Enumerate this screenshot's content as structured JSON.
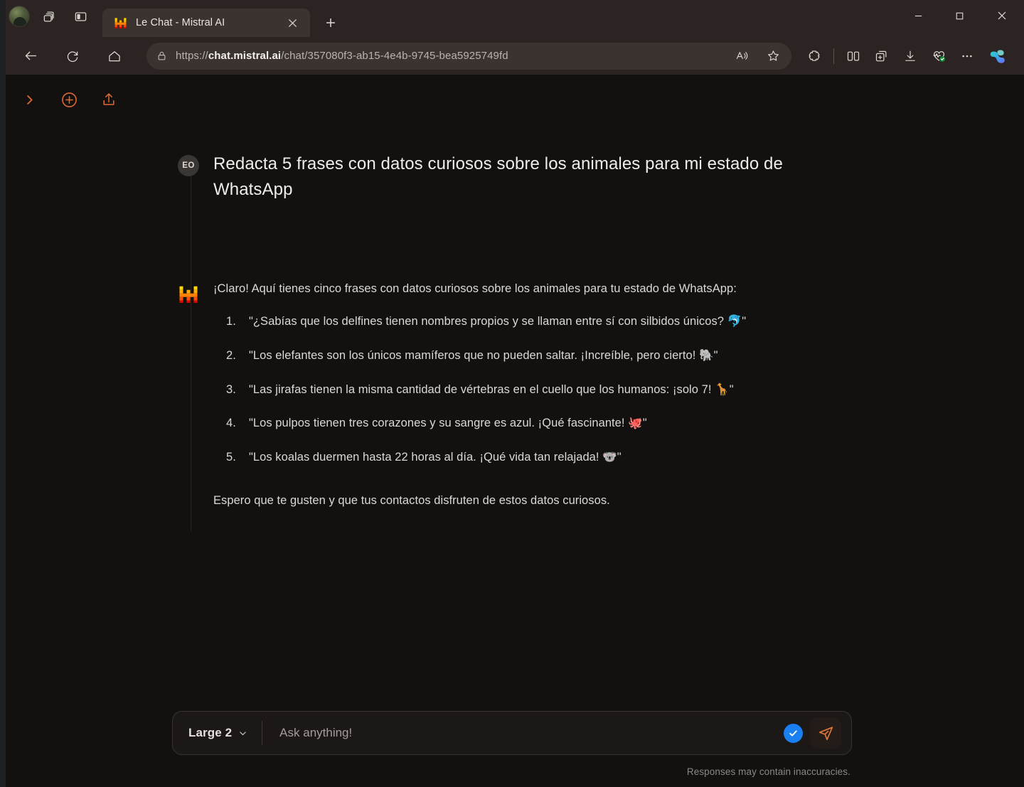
{
  "browser": {
    "tab": {
      "title": "Le Chat - Mistral AI",
      "favicon_name": "mistral-logo-icon",
      "close_label": "×"
    },
    "new_tab_label": "+",
    "omnibox": {
      "url_scheme": "https://",
      "url_host": "chat.mistral.ai",
      "url_path": "/chat/357080f3-ab15-4e4b-9745-bea5925749fd",
      "lock_icon": "lock-icon",
      "read_aloud_icon": "read-aloud-icon",
      "favorite_icon": "star-icon"
    },
    "nav": {
      "back_icon": "back-arrow-icon",
      "reload_icon": "reload-icon",
      "home_icon": "home-icon"
    },
    "toolbar_right": [
      {
        "name": "extensions-icon",
        "label": "Extensions"
      },
      {
        "name": "split-screen-icon",
        "label": "Split screen"
      },
      {
        "name": "collections-icon",
        "label": "Collections"
      },
      {
        "name": "downloads-icon",
        "label": "Downloads"
      },
      {
        "name": "browser-essentials-icon",
        "label": "Browser essentials"
      },
      {
        "name": "settings-more-icon",
        "label": "Settings and more"
      },
      {
        "name": "copilot-icon",
        "label": "Copilot"
      }
    ],
    "chrome_left": [
      {
        "name": "profile-avatar",
        "label": "Profile"
      },
      {
        "name": "workspaces-icon",
        "label": "Workspaces"
      },
      {
        "name": "tab-actions-icon",
        "label": "Tab actions"
      }
    ],
    "window_controls": {
      "minimize": "minimize-icon",
      "maximize": "maximize-icon",
      "close": "close-icon"
    }
  },
  "app": {
    "header_actions": [
      {
        "name": "expand-sidebar-button",
        "icon": "chevron-right-icon"
      },
      {
        "name": "new-chat-button",
        "icon": "plus-circle-icon"
      },
      {
        "name": "share-chat-button",
        "icon": "upload-share-icon"
      }
    ],
    "accent_color": "#e06a33"
  },
  "conversation": {
    "user": {
      "avatar_initials": "EO",
      "text": "Redacta 5 frases con datos curiosos sobre los animales para mi estado de WhatsApp"
    },
    "assistant": {
      "avatar_name": "mistral-logo-icon",
      "intro": "¡Claro! Aquí tienes cinco frases con datos curiosos sobre los animales para tu estado de WhatsApp:",
      "facts": [
        "\"¿Sabías que los delfines tienen nombres propios y se llaman entre sí con silbidos únicos? 🐬\"",
        "\"Los elefantes son los únicos mamíferos que no pueden saltar. ¡Increíble, pero cierto! 🐘\"",
        "\"Las jirafas tienen la misma cantidad de vértebras en el cuello que los humanos: ¡solo 7! 🦒\"",
        "\"Los pulpos tienen tres corazones y su sangre es azul. ¡Qué fascinante! 🐙\"",
        "\"Los koalas duermen hasta 22 horas al día. ¡Qué vida tan relajada! 🐨\""
      ],
      "outro": "Espero que te gusten y que tus contactos disfruten de estos datos curiosos."
    }
  },
  "composer": {
    "model_name": "Large 2",
    "model_chevron_icon": "chevron-down-icon",
    "placeholder": "Ask anything!",
    "input_value": "",
    "verified_badge_icon": "check-badge-icon",
    "send_icon": "send-plane-icon",
    "footnote": "Responses may contain inaccuracies."
  }
}
